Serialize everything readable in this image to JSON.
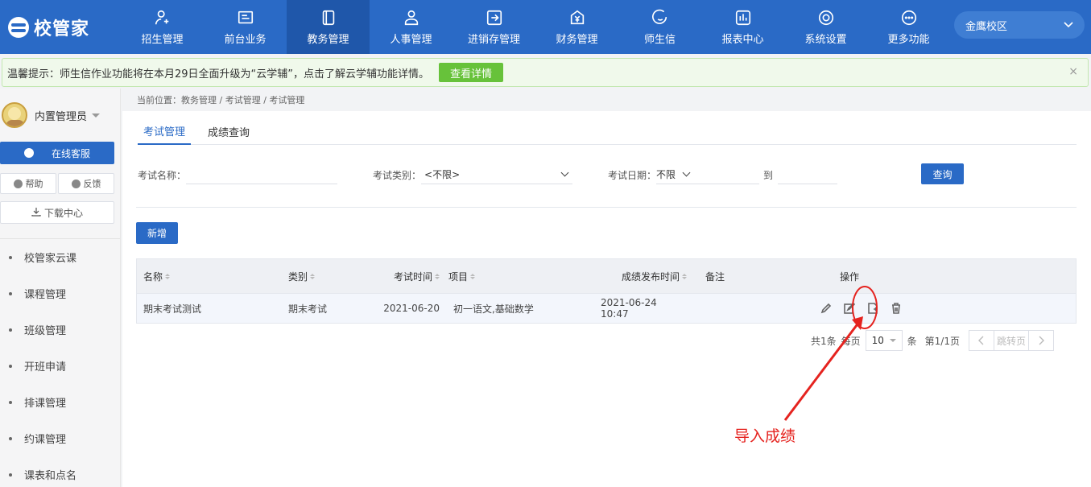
{
  "app": {
    "logo_text": "校管家"
  },
  "nav": {
    "items": [
      {
        "label": "招生管理",
        "icon": "user-plus-icon"
      },
      {
        "label": "前台业务",
        "icon": "desk-icon"
      },
      {
        "label": "教务管理",
        "icon": "book-icon",
        "active": true
      },
      {
        "label": "人事管理",
        "icon": "person-icon"
      },
      {
        "label": "进销存管理",
        "icon": "inventory-icon"
      },
      {
        "label": "财务管理",
        "icon": "finance-icon"
      },
      {
        "label": "师生信",
        "icon": "message-icon"
      },
      {
        "label": "报表中心",
        "icon": "report-icon"
      },
      {
        "label": "系统设置",
        "icon": "settings-icon"
      },
      {
        "label": "更多功能",
        "icon": "more-icon"
      }
    ],
    "campus": "金鹰校区"
  },
  "notice": {
    "text": "温馨提示：师生信作业功能将在本月29日全面升级为“云学辅”，点击了解云学辅功能详情。",
    "button": "查看详情",
    "close": "×"
  },
  "sidebar": {
    "user_name": "内置管理员",
    "service_button": "在线客服",
    "help": "帮助",
    "feedback": "反馈",
    "download": "下载中心",
    "menu": [
      "校管家云课",
      "课程管理",
      "班级管理",
      "开班申请",
      "排课管理",
      "约课管理",
      "课表和点名"
    ]
  },
  "breadcrumb": "当前位置：教务管理 / 考试管理 / 考试管理",
  "tabs": [
    "考试管理",
    "成绩查询"
  ],
  "filters": {
    "exam_name_label": "考试名称：",
    "exam_name_value": "",
    "exam_type_label": "考试类别：",
    "exam_type_value": "<不限>",
    "exam_date_label": "考试日期：",
    "exam_date_value": "不限",
    "to_label": "到",
    "query_button": "查询"
  },
  "add_button": "新增",
  "table": {
    "headers": [
      "名称",
      "类别",
      "考试时间",
      "项目",
      "成绩发布时间",
      "备注",
      "操作"
    ],
    "rows": [
      {
        "name": "期末考试测试",
        "type": "期末考试",
        "date": "2021-06-20",
        "project": "初一语文,基础数学",
        "publish": "2021-06-24 10:47",
        "note": ""
      }
    ]
  },
  "pagination": {
    "total": "共1条",
    "per_page_label": "每页",
    "per_page": "10",
    "unit": "条",
    "page": "第1/1页",
    "jump": "跳转页"
  },
  "annotation": {
    "text": "导入成绩",
    "color": "#e5231f"
  }
}
